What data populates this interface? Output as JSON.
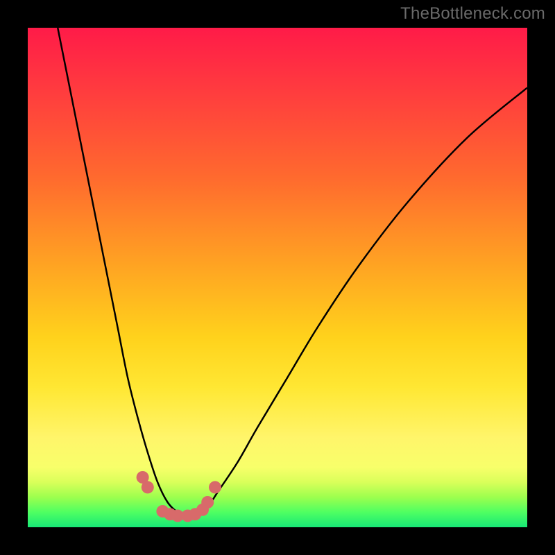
{
  "watermark": "TheBottleneck.com",
  "chart_data": {
    "type": "line",
    "title": "",
    "xlabel": "",
    "ylabel": "",
    "xlim": [
      0,
      100
    ],
    "ylim": [
      0,
      100
    ],
    "grid": false,
    "legend": false,
    "note": "V-shaped bottleneck curve. x is normalized horizontal position (0–100 across plot area), y is height above the plot bottom (0–100). The curve descends steeply from top-left to a flat minimum near x≈27–34 at y≈2, then rises toward the upper-right. Pink marker points sit along the curve near the trough.",
    "series": [
      {
        "name": "bottleneck-curve",
        "x": [
          6,
          8,
          10,
          12,
          14,
          16,
          18,
          20,
          22,
          24,
          26,
          28,
          30,
          32,
          34,
          36,
          38,
          42,
          46,
          52,
          58,
          66,
          76,
          88,
          100
        ],
        "y": [
          100,
          90,
          80,
          70,
          60,
          50,
          40,
          30,
          22,
          15,
          9,
          5,
          3,
          2.2,
          2.5,
          4,
          7,
          13,
          20,
          30,
          40,
          52,
          65,
          78,
          88
        ]
      }
    ],
    "markers": {
      "name": "trough-points",
      "color": "#d86a6a",
      "x": [
        23,
        24,
        27,
        28.5,
        30,
        32,
        33.5,
        35,
        36,
        37.5
      ],
      "y": [
        10,
        8,
        3.2,
        2.6,
        2.3,
        2.3,
        2.6,
        3.5,
        5,
        8
      ]
    },
    "gradient": {
      "top": "#ff1b48",
      "bottom": "#17e876",
      "meaning": "red = high bottleneck, green = balanced"
    }
  }
}
